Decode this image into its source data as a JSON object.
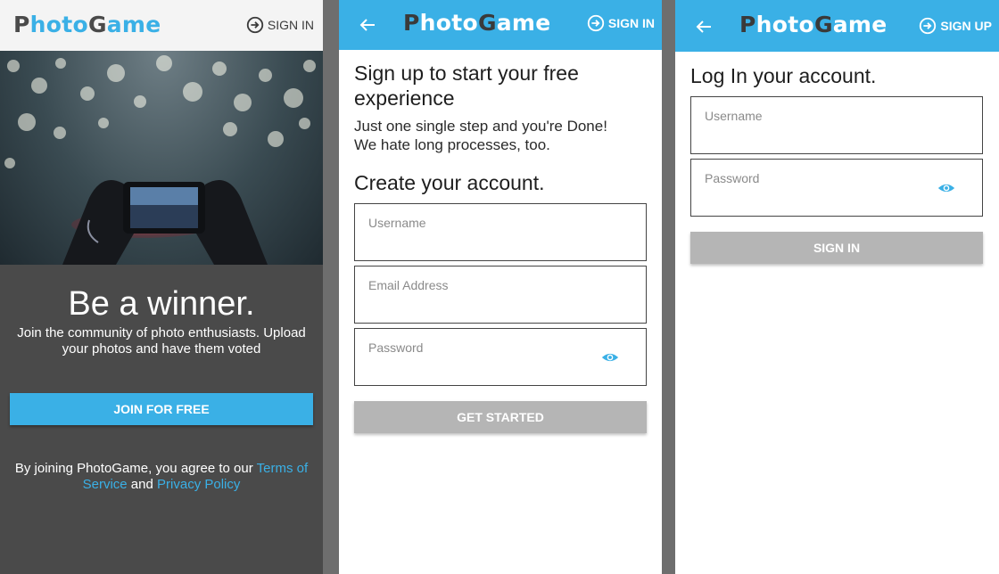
{
  "brand": {
    "letter_p": "P",
    "hoto": "hoto",
    "letter_g": "G",
    "ame": "ame"
  },
  "landing": {
    "header_action": "SIGN IN",
    "title": "Be a winner.",
    "subtitle": "Join the community of photo enthusiasts. Upload your photos and have them voted",
    "join_button": "JOIN FOR FREE",
    "terms_prefix": "By joining PhotoGame, you agree to our ",
    "terms_link": "Terms of Service",
    "terms_and": " and ",
    "privacy_link": "Privacy Policy"
  },
  "signup": {
    "header_action": "SIGN IN",
    "heading": "Sign up to start your free experience",
    "subtext_line1": "Just one single step and you're Done!",
    "subtext_line2": "We hate long processes, too.",
    "create_heading": "Create your account.",
    "username_placeholder": "Username",
    "email_placeholder": "Email Address",
    "password_placeholder": "Password",
    "submit_button": "GET STARTED"
  },
  "login": {
    "header_action": "SIGN UP",
    "heading": "Log In your account.",
    "username_placeholder": "Username",
    "password_placeholder": "Password",
    "submit_button": "SIGN IN"
  },
  "colors": {
    "accent": "#3ab0e6",
    "dark": "#4a4a4a",
    "disabled": "#b5b5b5"
  }
}
